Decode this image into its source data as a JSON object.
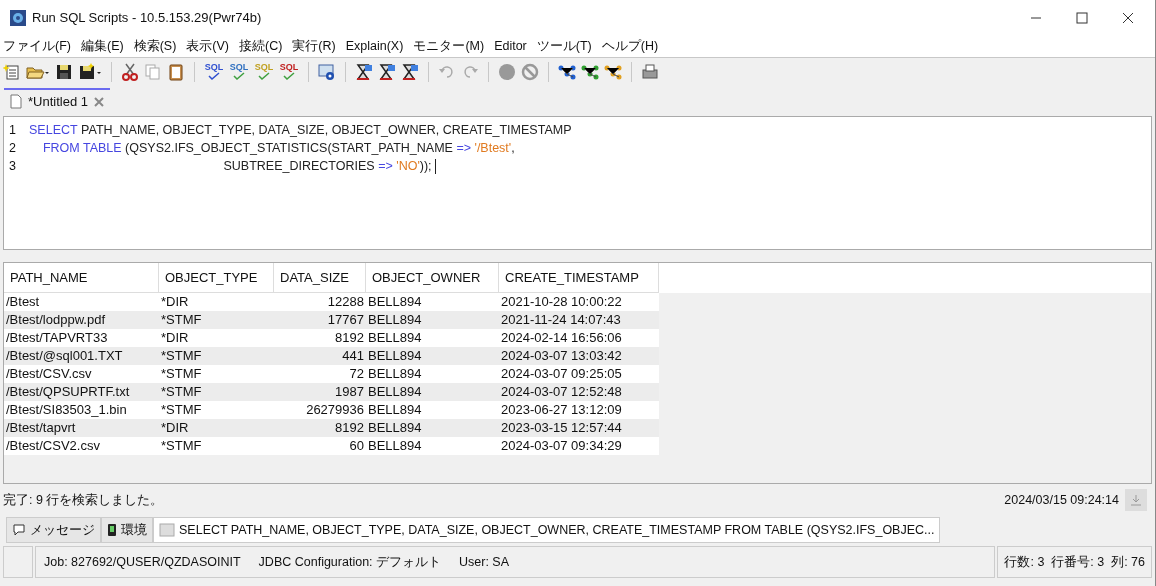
{
  "window": {
    "title": "Run SQL Scripts - 10.5.153.29(Pwr74b)"
  },
  "menu": [
    "ファイル(F)",
    "編集(E)",
    "検索(S)",
    "表示(V)",
    "接続(C)",
    "実行(R)",
    "Explain(X)",
    "モニター(M)",
    "Editor",
    "ツール(T)",
    "ヘルプ(H)"
  ],
  "toolbar": {
    "sql_buttons": [
      "SQL",
      "SQL",
      "SQL",
      "SQL"
    ]
  },
  "tabs": [
    {
      "label": "*Untitled 1",
      "selected": true
    }
  ],
  "editor": {
    "lines": [
      {
        "number": "1",
        "tokens": [
          {
            "text": "SELECT",
            "kind": "keyword"
          },
          {
            "text": " PATH_NAME, OBJECT_TYPE, DATA_SIZE, OBJECT_OWNER, CREATE_TIMESTAMP",
            "kind": "plain"
          }
        ]
      },
      {
        "number": "2",
        "tokens": [
          {
            "text": "    FROM TABLE",
            "kind": "keyword"
          },
          {
            "text": " (QSYS2.IFS_OBJECT_STATISTICS(START_PATH_NAME ",
            "kind": "plain"
          },
          {
            "text": "=>",
            "kind": "keyword"
          },
          {
            "text": " '/Btest'",
            "kind": "string"
          },
          {
            "text": ",",
            "kind": "plain"
          }
        ]
      },
      {
        "number": "3",
        "tokens": [
          {
            "text": "                                                        SUBTREE_DIRECTORIES ",
            "kind": "plain"
          },
          {
            "text": "=>",
            "kind": "keyword"
          },
          {
            "text": " 'NO'",
            "kind": "string"
          },
          {
            "text": ")); ",
            "kind": "plain"
          }
        ]
      }
    ]
  },
  "results": {
    "columns": [
      {
        "label": "PATH_NAME"
      },
      {
        "label": "OBJECT_TYPE"
      },
      {
        "label": "DATA_SIZE"
      },
      {
        "label": "OBJECT_OWNER"
      },
      {
        "label": "CREATE_TIMESTAMP"
      }
    ],
    "rows": [
      [
        "/Btest",
        "*DIR",
        "12288",
        "BELL894",
        "2021-10-28 10:00:22"
      ],
      [
        "/Btest/lodppw.pdf",
        "*STMF",
        "17767",
        "BELL894",
        "2021-11-24 14:07:43"
      ],
      [
        "/Btest/TAPVRT33",
        "*DIR",
        "8192",
        "BELL894",
        "2024-02-14 16:56:06"
      ],
      [
        "/Btest/@sql001.TXT",
        "*STMF",
        "441",
        "BELL894",
        "2024-03-07 13:03:42"
      ],
      [
        "/Btest/CSV.csv",
        "*STMF",
        "72",
        "BELL894",
        "2024-03-07 09:25:05"
      ],
      [
        "/Btest/QPSUPRTF.txt",
        "*STMF",
        "1987",
        "BELL894",
        "2024-03-07 12:52:48"
      ],
      [
        "/Btest/SI83503_1.bin",
        "*STMF",
        "26279936",
        "BELL894",
        "2023-06-27 13:12:09"
      ],
      [
        "/Btest/tapvrt",
        "*DIR",
        "8192",
        "BELL894",
        "2023-03-15 12:57:44"
      ],
      [
        "/Btest/CSV2.csv",
        "*STMF",
        "60",
        "BELL894",
        "2024-03-07 09:34:29"
      ]
    ]
  },
  "message": {
    "text": "完了: 9 行を検索しました。",
    "time": "2024/03/15 09:24:14"
  },
  "bottom_tabs": [
    {
      "label": "メッセージ",
      "kind": "messages",
      "selected": false
    },
    {
      "label": "環境",
      "kind": "environment",
      "selected": false
    },
    {
      "label": "SELECT PATH_NAME, OBJECT_TYPE, DATA_SIZE, OBJECT_OWNER, CREATE_TIMESTAMP FROM TABLE (QSYS2.IFS_OBJEC...",
      "kind": "result",
      "selected": true
    }
  ],
  "status_bar": {
    "job": "Job: 827692/QUSER/QZDASOINIT",
    "jdbc": "JDBC Configuration: デフォルト",
    "user": "User: SA",
    "position": "行数: 3  行番号: 3  列: 76"
  }
}
